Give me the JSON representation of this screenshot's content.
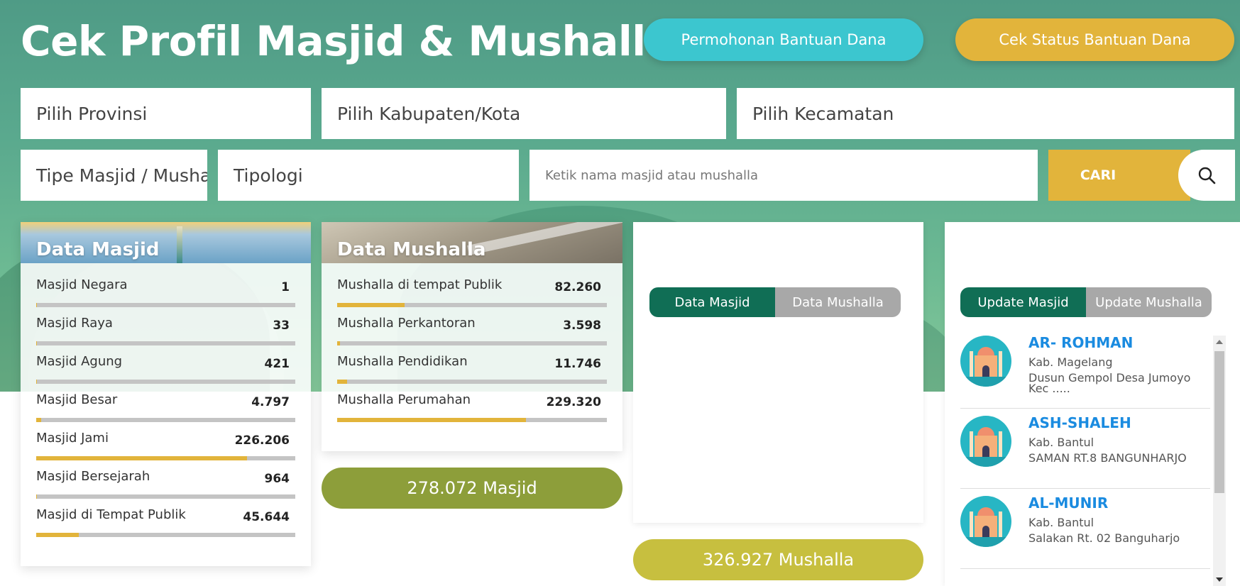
{
  "header": {
    "title": "Cek Profil Masjid & Mushalla",
    "btn_permohonan": "Permohonan Bantuan Dana",
    "btn_status": "Cek Status Bantuan Dana"
  },
  "filters": {
    "provinsi": "Pilih Provinsi",
    "kabupaten": "Pilih Kabupaten/Kota",
    "kecamatan": "Pilih Kecamatan",
    "tipe": "Tipe Masjid / Mushalla",
    "tipologi": "Tipologi",
    "search_placeholder": "Ketik nama masjid atau mushalla",
    "cari_label": "CARI"
  },
  "data_masjid": {
    "title": "Data Masjid",
    "rows": [
      {
        "label": "Masjid Negara",
        "value": "1",
        "fraction": 0.0
      },
      {
        "label": "Masjid Raya",
        "value": "33",
        "fraction": 0.0
      },
      {
        "label": "Masjid Agung",
        "value": "421",
        "fraction": 0.002
      },
      {
        "label": "Masjid Besar",
        "value": "4.797",
        "fraction": 0.02
      },
      {
        "label": "Masjid Jami",
        "value": "226.206",
        "fraction": 0.814
      },
      {
        "label": "Masjid Bersejarah",
        "value": "964",
        "fraction": 0.003
      },
      {
        "label": "Masjid di Tempat Publik",
        "value": "45.644",
        "fraction": 0.164
      }
    ],
    "total": "278.072 Masjid"
  },
  "data_mushalla": {
    "title": "Data Mushalla",
    "rows": [
      {
        "label": "Mushalla di tempat Publik",
        "value": "82.260",
        "fraction": 0.25
      },
      {
        "label": "Mushalla Perkantoran",
        "value": "3.598",
        "fraction": 0.011
      },
      {
        "label": "Mushalla Pendidikan",
        "value": "11.746",
        "fraction": 0.036
      },
      {
        "label": "Mushalla Perumahan",
        "value": "229.320",
        "fraction": 0.7
      }
    ],
    "total": "326.927 Mushalla"
  },
  "chart_panel": {
    "tab_active": "Data Masjid",
    "tab_inactive": "Data Mushalla"
  },
  "update_panel": {
    "tab_active": "Update Masjid",
    "tab_inactive": "Update Mushalla",
    "items": [
      {
        "name": "AR- ROHMAN",
        "kab": "Kab. Magelang",
        "addr": "Dusun Gempol Desa Jumoyo Kec ....."
      },
      {
        "name": "ASH-SHALEH",
        "kab": "Kab. Bantul",
        "addr": "SAMAN RT.8 BANGUNHARJO"
      },
      {
        "name": "AL-MUNIR",
        "kab": "Kab. Bantul",
        "addr": "Salakan Rt. 02 Banguharjo"
      }
    ]
  },
  "colors": {
    "accent_teal": "#106e55",
    "gold": "#e2b43b",
    "cyan": "#3cc6cf",
    "olive": "#8d9e3a",
    "mustard": "#c7bf3f",
    "link_blue": "#1a8be0"
  },
  "icons": {
    "search": "search-icon",
    "mosque": "mosque-icon"
  }
}
